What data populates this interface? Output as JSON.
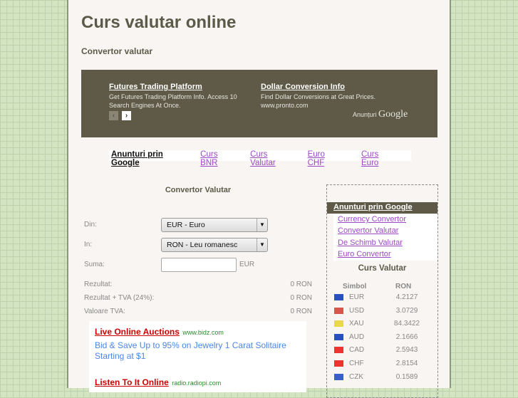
{
  "header": {
    "title": "Curs valutar online",
    "subtitle": "Convertor valutar"
  },
  "top_ads": [
    {
      "title": "Futures Trading Platform",
      "desc": "Get Futures Trading Platform Info. Access 10 Search Engines At Once."
    },
    {
      "title": "Dollar Conversion Info",
      "desc": "Find Dollar Conversions at Great Prices.",
      "url": "www.pronto.com"
    }
  ],
  "top_ads_brand": {
    "prefix": "Anunțuri",
    "brand": "Google"
  },
  "link_bar": {
    "label": "Anunturi prin Google",
    "links": [
      "Curs BNR",
      "Curs Valutar",
      "Euro CHF",
      "Curs Euro"
    ]
  },
  "converter": {
    "title": "Convertor Valutar",
    "from_label": "Din:",
    "from_value": "EUR - Euro",
    "to_label": "In:",
    "to_value": "RON - Leu romanesc",
    "amount_label": "Suma:",
    "amount_value": "",
    "amount_unit": "EUR",
    "results": [
      {
        "label": "Rezultat:",
        "value": "0 RON"
      },
      {
        "label": "Rezultat + TVA (24%):",
        "value": "0 RON"
      },
      {
        "label": "Valoare TVA:",
        "value": "0 RON"
      }
    ]
  },
  "bottom_ads": [
    {
      "title": "Live Online Auctions",
      "domain": "www.bidz.com",
      "desc": "Bid & Save Up to 95% on Jewelry 1 Carat Solitaire Starting at $1"
    },
    {
      "title": "Listen To It Online",
      "domain": "radio.radiopi.com"
    }
  ],
  "sidebar": {
    "ads_label": "Anunturi prin Google",
    "links": [
      "Currency Convertor",
      "Convertor Valutar",
      "De Schimb Valutar",
      "Euro Convertor"
    ],
    "rates_title": "Curs Valutar",
    "col_symbol": "Simbol",
    "col_ron": "RON",
    "rates": [
      {
        "sym": "EUR",
        "val": "4.2127",
        "flag": "#2a4fc0"
      },
      {
        "sym": "USD",
        "val": "3.0729",
        "flag": "#d9534f"
      },
      {
        "sym": "XAU",
        "val": "84.3422",
        "flag": "#e8d84a"
      },
      {
        "sym": "AUD",
        "val": "2.1666",
        "flag": "#2a4fc0"
      },
      {
        "sym": "CAD",
        "val": "2.5943",
        "flag": "#e33"
      },
      {
        "sym": "CHF",
        "val": "2.8154",
        "flag": "#e33"
      },
      {
        "sym": "CZK",
        "val": "0.1589",
        "flag": "#3a5fc8"
      }
    ]
  }
}
